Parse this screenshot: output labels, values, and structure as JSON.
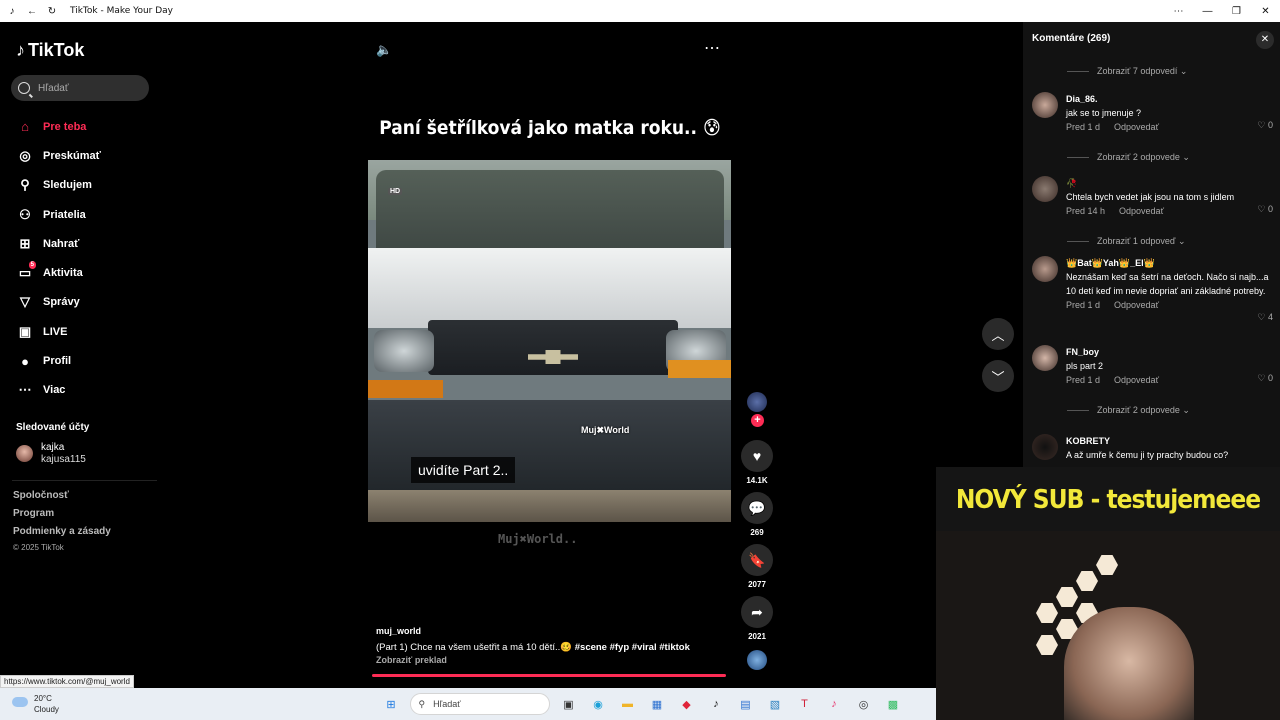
{
  "window": {
    "title": "TikTok - Make Your Day"
  },
  "sidebar": {
    "logo": "TikTok",
    "search_placeholder": "Hľadať",
    "items": [
      {
        "label": "Pre teba",
        "icon": "home-icon",
        "glyph": "⌂",
        "active": true
      },
      {
        "label": "Preskúmať",
        "icon": "compass-icon",
        "glyph": "◎"
      },
      {
        "label": "Sledujem",
        "icon": "user-follow-icon",
        "glyph": "⚲"
      },
      {
        "label": "Priatelia",
        "icon": "friends-icon",
        "glyph": "⚇"
      },
      {
        "label": "Nahrať",
        "icon": "upload-icon",
        "glyph": "⊞"
      },
      {
        "label": "Aktivita",
        "icon": "activity-icon",
        "glyph": "▭",
        "badge": "5"
      },
      {
        "label": "Správy",
        "icon": "messages-icon",
        "glyph": "▽"
      },
      {
        "label": "LIVE",
        "icon": "live-icon",
        "glyph": "▣"
      },
      {
        "label": "Profil",
        "icon": "profile-icon",
        "glyph": "●"
      },
      {
        "label": "Viac",
        "icon": "more-icon",
        "glyph": "⋯"
      }
    ],
    "following_heading": "Sledované účty",
    "following": [
      {
        "name": "kajka",
        "username": "kajusa115"
      }
    ],
    "footer": [
      "Spoločnosť",
      "Program",
      "Podmienky a zásady"
    ],
    "copyright": "© 2025 TikTok"
  },
  "status_url": "https://www.tiktok.com/@muj_world",
  "video": {
    "title": "Paní šetřílková jako matka roku.. 😰",
    "caption": "uvidíte Part 2..",
    "watermark": "Muj✖World",
    "watermark_below": "Muj✖World..",
    "hd_label": "HD",
    "author": "muj_world",
    "description": "(Part 1) Chce na všem ušetřit a má 10 dětí..🥴 ",
    "hashtags": "#scene  #fyp  #viral  #tiktok",
    "translate": "Zobraziť preklad",
    "likes": "14.1K",
    "comments": "269",
    "saves": "2077",
    "shares": "2021"
  },
  "comments_panel": {
    "header": "Komentáre (269)",
    "items": [
      {
        "name": "Dia_86.",
        "text": "jak se to jmenuje ?",
        "time": "Pred 1 d",
        "reply": "Odpovedať",
        "likes": "0",
        "replies": "Zobraziť 2 odpovede ⌄",
        "color": "#c9a99a"
      },
      {
        "name": "🥀",
        "text": "Chtela bych vedet jak jsou na tom s jidlem",
        "time": "Pred 14 h",
        "reply": "Odpovedať",
        "likes": "0",
        "replies": "Zobraziť 1 odpoveď ⌄",
        "color": "#8a7a70"
      },
      {
        "name": "👑Bat👑Yah👑_El👑",
        "text": "Neznášam keď sa šetrí na deťoch. Načo si najb...a 10 detí keď im nevie dopriať ani základné potreby.",
        "time": "Pred 1 d",
        "reply": "Odpovedať",
        "likes": "4",
        "color": "#b89a8c"
      },
      {
        "name": "FN_boy",
        "text": "pls part 2",
        "time": "Pred 1 d",
        "reply": "Odpovedať",
        "likes": "0",
        "replies": "Zobraziť 2 odpovede ⌄",
        "color": "#d4b6a8"
      },
      {
        "name": "KOBRETY",
        "text": "A až umře k čemu ji ty prachy budou co?",
        "color": "#111111"
      }
    ],
    "top_replies": "Zobraziť 7 odpovedí ⌄"
  },
  "stream": {
    "banner": "NOVÝ SUB - testujemeee"
  },
  "taskbar": {
    "temp": "20°C",
    "weather": "Cloudy",
    "search": "Hľadať",
    "apps": [
      {
        "icon": "windows-icon",
        "glyph": "⊞",
        "color": "#1f7ae0"
      },
      {
        "icon": "taskview-icon",
        "glyph": "▣",
        "color": "#333"
      },
      {
        "icon": "edge-icon",
        "glyph": "◉",
        "color": "#1aa0d8"
      },
      {
        "icon": "folder-icon",
        "glyph": "▬",
        "color": "#f0b429"
      },
      {
        "icon": "store-icon",
        "glyph": "▦",
        "color": "#2a6fd0"
      },
      {
        "icon": "app-red-icon",
        "glyph": "◆",
        "color": "#e0243a"
      },
      {
        "icon": "tiktok-icon",
        "glyph": "♪",
        "color": "#111"
      },
      {
        "icon": "notes-icon",
        "glyph": "▤",
        "color": "#2a6fd0"
      },
      {
        "icon": "photos-icon",
        "glyph": "▧",
        "color": "#2a80c0"
      },
      {
        "icon": "text-icon",
        "glyph": "T",
        "color": "#d0223a"
      },
      {
        "icon": "tiktok-pink-icon",
        "glyph": "♪",
        "color": "#e8356d"
      },
      {
        "icon": "obs-icon",
        "glyph": "◎",
        "color": "#333"
      },
      {
        "icon": "android-icon",
        "glyph": "▩",
        "color": "#2dbb5d"
      }
    ]
  }
}
